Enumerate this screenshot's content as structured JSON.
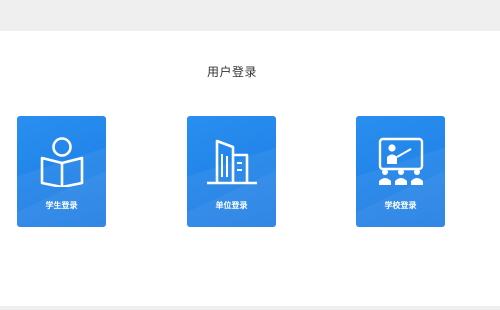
{
  "page": {
    "title": "用户登录"
  },
  "cards": [
    {
      "label": "学生登录",
      "icon": "student-reading-icon"
    },
    {
      "label": "单位登录",
      "icon": "office-building-icon"
    },
    {
      "label": "学校登录",
      "icon": "teacher-classroom-icon"
    }
  ],
  "colors": {
    "card_bg": "#1f84ea",
    "bar_bg": "#efefef",
    "title_text": "#333333"
  }
}
